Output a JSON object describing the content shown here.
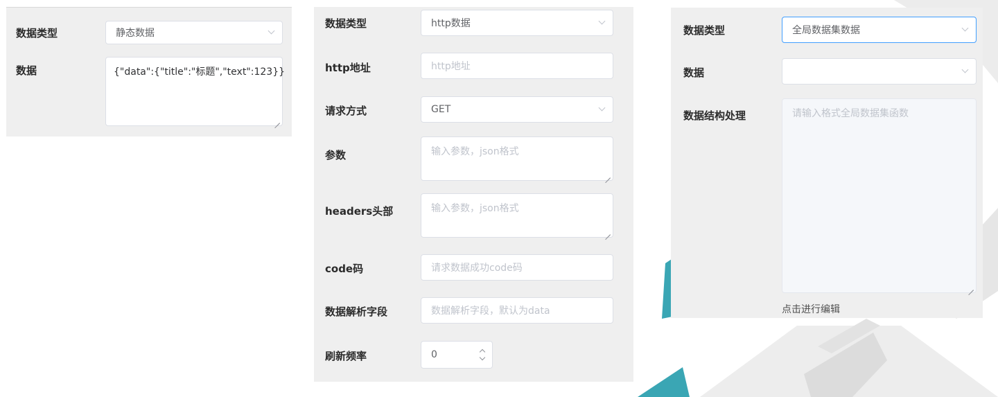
{
  "static_panel": {
    "type_label": "数据类型",
    "type_value": "静态数据",
    "data_label": "数据",
    "data_value": "{\"data\":{\"title\":\"标题\",\"text\":123}}"
  },
  "http_panel": {
    "type_label": "数据类型",
    "type_value": "http数据",
    "url_label": "http地址",
    "url_placeholder": "http地址",
    "method_label": "请求方式",
    "method_value": "GET",
    "params_label": "参数",
    "params_placeholder": "输入参数，json格式",
    "headers_label": "headers头部",
    "headers_placeholder": "输入参数，json格式",
    "code_label": "code码",
    "code_placeholder": "请求数据成功code码",
    "parse_label": "数据解析字段",
    "parse_placeholder": "数据解析字段，默认为data",
    "refresh_label": "刷新频率",
    "refresh_value": "0"
  },
  "global_panel": {
    "type_label": "数据类型",
    "type_value": "全局数据集数据",
    "data_label": "数据",
    "data_value": "",
    "struct_label": "数据结构处理",
    "struct_placeholder": "请输入格式全局数据集函数",
    "edit_hint": "点击进行编辑"
  },
  "colors": {
    "panel_bg": "#efefef",
    "focus_border": "#409eff",
    "deco_teal": "#3aa6b4",
    "deco_gray": "#e9e9e9"
  }
}
